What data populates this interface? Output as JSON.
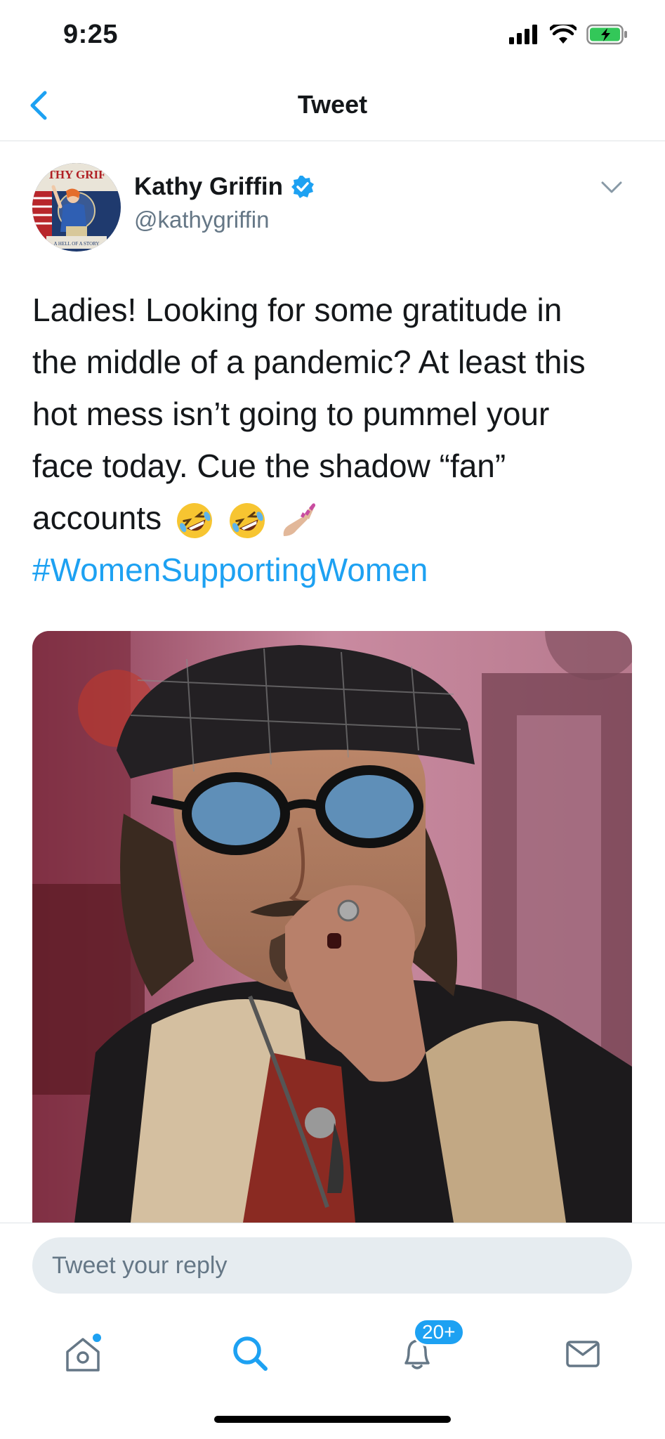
{
  "status_bar": {
    "time": "9:25",
    "icons": [
      "signal-icon",
      "wifi-icon",
      "battery-charging-icon"
    ]
  },
  "nav": {
    "title": "Tweet",
    "back_icon": "chevron-left-icon"
  },
  "author": {
    "name": "Kathy Griffin",
    "handle": "@kathygriffin",
    "verified": true,
    "avatar_text_top": "THY GRIF",
    "avatar_text_bottom": "A HELL OF A STORY"
  },
  "tweet": {
    "lines": [
      "Ladies! Looking for some gratitude in",
      "the middle of a pandemic? At least this",
      "hot mess isn’t going to pummel your",
      "face today. Cue the shadow “fan”"
    ],
    "last_line": "accounts",
    "emojis": [
      "🤣",
      "🤣",
      "💅🏼"
    ],
    "hashtag": "#WomenSupportingWomen"
  },
  "reply": {
    "placeholder": "Tweet your reply"
  },
  "tabs": {
    "home": "home-icon",
    "search": "search-icon",
    "notifications": "bell-icon",
    "notifications_badge": "20+",
    "messages": "envelope-icon"
  },
  "colors": {
    "accent": "#1da1f2",
    "text": "#14171a",
    "secondary": "#657786",
    "input_bg": "#e6ecf0"
  }
}
